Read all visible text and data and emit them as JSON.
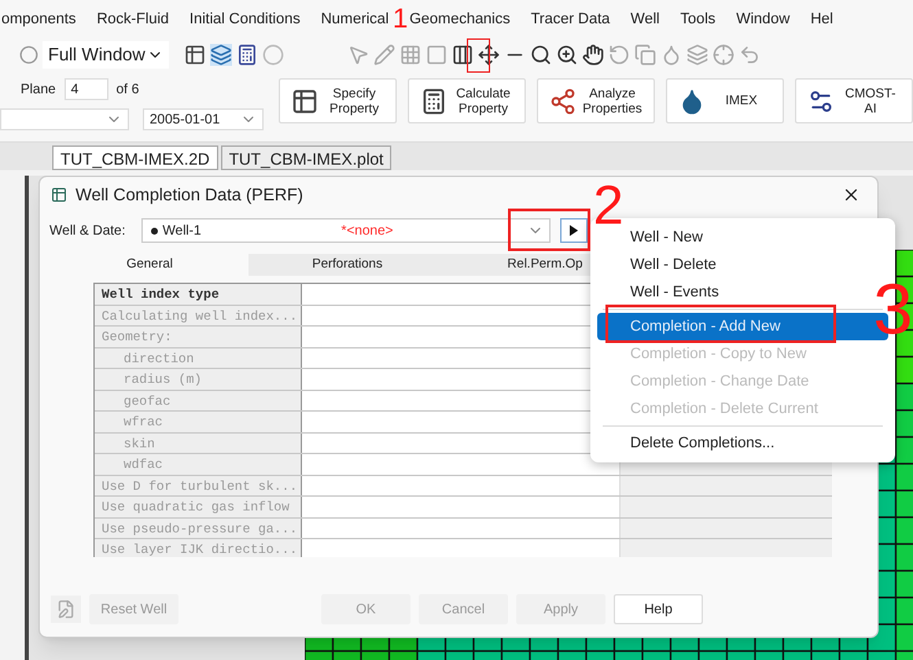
{
  "menu_bar": [
    "omponents",
    "Rock-Fluid",
    "Initial Conditions",
    "Numerical",
    "Geomechanics",
    "Tracer Data",
    "Well",
    "Tools",
    "Window",
    "Hel"
  ],
  "toolbar": {
    "view_select": "Full Window"
  },
  "ribbon": {
    "plane_label": "Plane",
    "plane_value": "4",
    "plane_of": "of 6",
    "date": "2005-01-01",
    "buttons": [
      {
        "kind": "specify",
        "label": "Specify Property"
      },
      {
        "kind": "calculate",
        "label": "Calculate Property"
      },
      {
        "kind": "analyze",
        "label": "Analyze Properties"
      },
      {
        "kind": "imex",
        "label": "IMEX"
      },
      {
        "kind": "cmost",
        "label": "CMOST-AI"
      }
    ]
  },
  "doc_tabs": [
    {
      "label": "TUT_CBM-IMEX.2D",
      "selected": true
    },
    {
      "label": "TUT_CBM-IMEX.plot",
      "selected": false
    }
  ],
  "dialog": {
    "title": "Well Completion Data (PERF)",
    "well_date_label": "Well & Date:",
    "well": "Well-1",
    "date_value": "*<none>",
    "tabs": [
      {
        "label": "General",
        "selected": true
      },
      {
        "label": "Perforations",
        "selected": false
      },
      {
        "label": "Rel.Perm.Op",
        "selected": false
      }
    ],
    "rows": [
      {
        "label": "Well index type",
        "disabled": false
      },
      {
        "label": "Calculating well index...",
        "disabled": true
      },
      {
        "label": "Geometry:",
        "disabled": true,
        "children": [
          {
            "label": "direction",
            "disabled": true
          },
          {
            "label": "radius (m)",
            "disabled": true
          },
          {
            "label": "geofac",
            "disabled": true
          },
          {
            "label": "wfrac",
            "disabled": true
          },
          {
            "label": "skin",
            "disabled": true
          },
          {
            "label": "wdfac",
            "disabled": true
          }
        ]
      },
      {
        "label": "Use D for turbulent sk...",
        "disabled": true
      },
      {
        "label": "Use quadratic gas inflow",
        "disabled": true
      },
      {
        "label": "Use pseudo-pressure ga...",
        "disabled": true
      },
      {
        "label": "Use layer IJK directio...",
        "disabled": true
      }
    ],
    "buttons": [
      {
        "label": "Reset Well",
        "disabled": true
      },
      {
        "label": "OK",
        "disabled": true
      },
      {
        "label": "Cancel",
        "disabled": true
      },
      {
        "label": "Apply",
        "disabled": true
      },
      {
        "label": "Help",
        "disabled": false
      }
    ]
  },
  "context_menu": {
    "groups": [
      [
        {
          "label": "Well - New",
          "disabled": false,
          "selected": false
        },
        {
          "label": "Well - Delete",
          "disabled": false,
          "selected": false
        },
        {
          "label": "Well - Events",
          "disabled": false,
          "selected": false
        }
      ],
      [
        {
          "label": "Completion - Add New",
          "disabled": false,
          "selected": true
        },
        {
          "label": "Completion - Copy to New",
          "disabled": true,
          "selected": false
        },
        {
          "label": "Completion - Change Date",
          "disabled": true,
          "selected": false
        },
        {
          "label": "Completion - Delete Current",
          "disabled": true,
          "selected": false
        }
      ],
      [
        {
          "label": "Delete Completions...",
          "disabled": false,
          "selected": false
        }
      ]
    ]
  },
  "annotations": [
    {
      "label": "1"
    },
    {
      "label": "2"
    },
    {
      "label": "3"
    }
  ]
}
